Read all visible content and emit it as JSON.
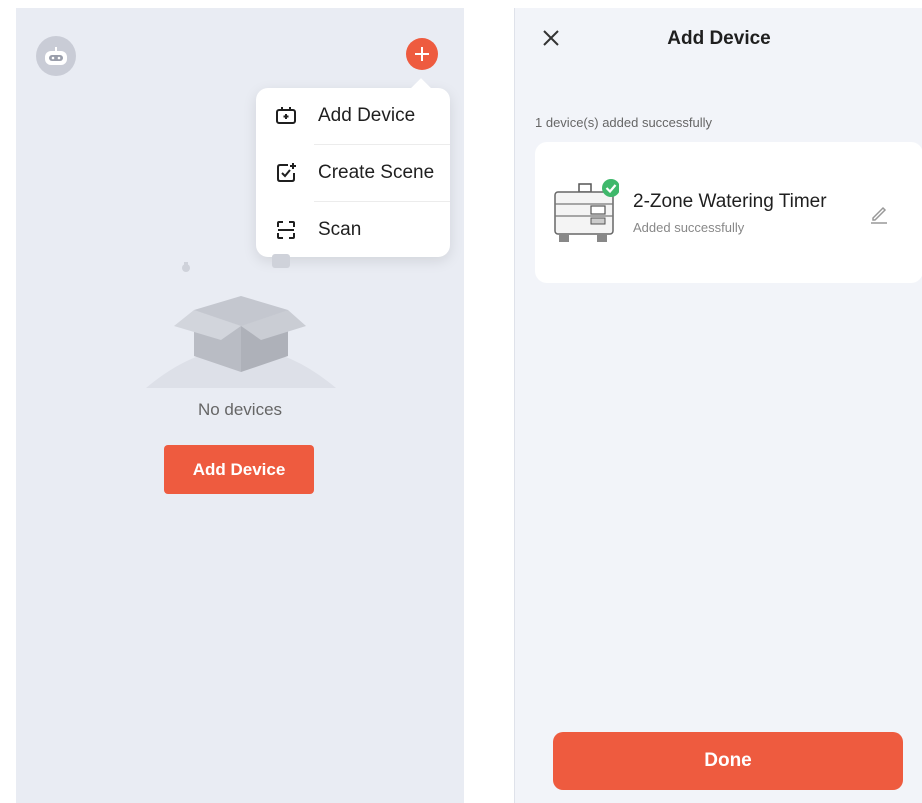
{
  "left_screen": {
    "menu": {
      "items": [
        {
          "label": "Add Device",
          "icon": "add-device-icon"
        },
        {
          "label": "Create Scene",
          "icon": "create-scene-icon"
        },
        {
          "label": "Scan",
          "icon": "scan-icon"
        }
      ]
    },
    "empty_state": {
      "text": "No devices",
      "button_label": "Add Device"
    }
  },
  "right_screen": {
    "title": "Add Device",
    "added_message": "1 device(s) added successfully",
    "device": {
      "name": "2-Zone Watering Timer",
      "status": "Added successfully"
    },
    "done_label": "Done"
  },
  "colors": {
    "accent": "#ee5b3f",
    "success": "#3fb86b",
    "background": "#e9ecf3"
  }
}
